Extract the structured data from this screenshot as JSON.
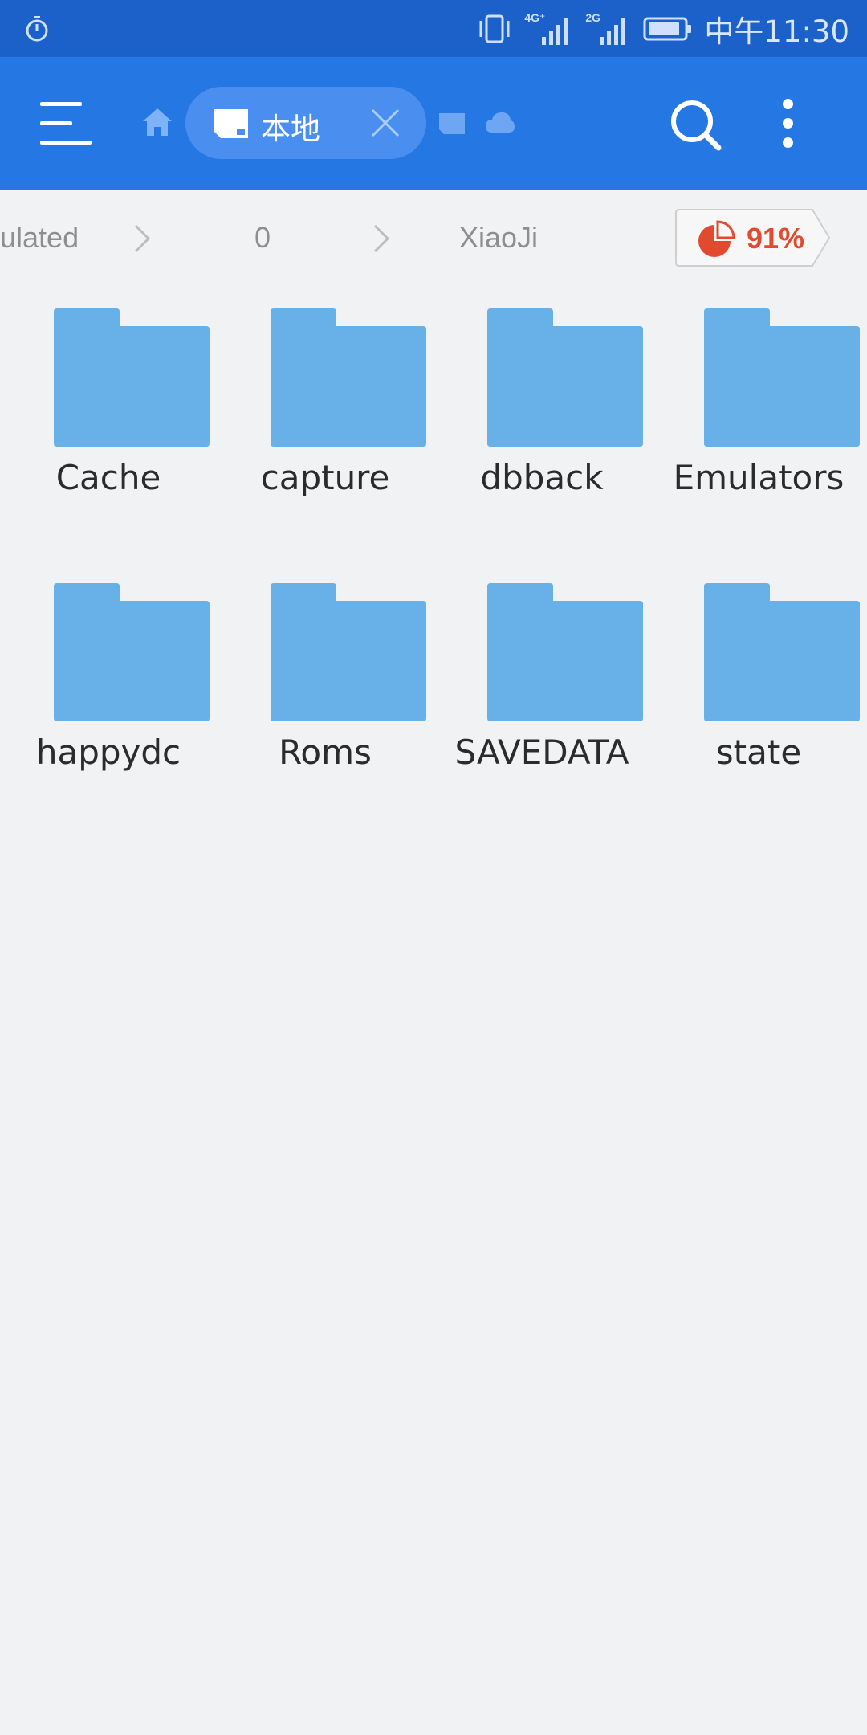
{
  "status_bar": {
    "time": "中午11:30",
    "network_1": "4G⁺",
    "network_2": "2G",
    "icons": [
      "timer-icon",
      "vibrate-icon",
      "signal-4g-icon",
      "signal-2g-icon",
      "battery-icon"
    ]
  },
  "toolbar": {
    "active_tab_label": "本地",
    "icons": [
      "menu-icon",
      "home-icon",
      "sd-card-icon",
      "close-icon",
      "sd-card-small-icon",
      "cloud-icon",
      "search-icon",
      "more-vert-icon"
    ]
  },
  "breadcrumb": {
    "items": [
      "ulated",
      "0",
      "XiaoJi"
    ],
    "storage_usage": "91%",
    "storage_usage_value": 0.91
  },
  "folders": [
    {
      "name": "Cache"
    },
    {
      "name": "capture"
    },
    {
      "name": "dbback"
    },
    {
      "name": "Emulators"
    },
    {
      "name": "happydc"
    },
    {
      "name": "Roms"
    },
    {
      "name": "SAVEDATA"
    },
    {
      "name": "state"
    }
  ],
  "colors": {
    "status_bar": "#1c61c9",
    "toolbar": "#2577e3",
    "active_tab": "#4a8ff0",
    "folder": "#68b0e8",
    "background": "#f1f2f4",
    "storage_accent": "#e14a2e"
  }
}
